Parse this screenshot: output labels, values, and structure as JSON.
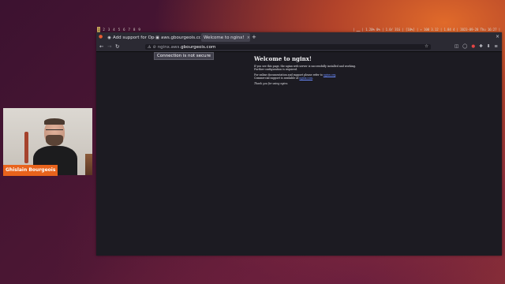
{
  "system_bar": {
    "workspaces": [
      "1",
      "2",
      "3",
      "4",
      "5",
      "6",
      "7",
      "8",
      "9"
    ],
    "active_workspace_index": 0,
    "status_text": "| ▁▁ | 1.20% 0% | 1.0/ 31G | [10%] | ↑ 100 3.12 | 1.84 4 | 2023-09-28 Thu 16:27 |"
  },
  "browser": {
    "menu_icon": "firefox-menu-icon",
    "tabs": [
      {
        "label": "Add support for OpenTelemetr",
        "icon": "github-icon",
        "active": false
      },
      {
        "label": "aws.gbourgeois.com",
        "icon": "generic-page-icon",
        "active": false
      },
      {
        "label": "Welcome to nginx!",
        "icon": "",
        "active": true
      }
    ],
    "new_tab_label": "+",
    "window_close_label": "×",
    "url": {
      "prefix": "nginx.aws.",
      "host": "gbourgeois.com"
    },
    "tooltip": "Connection is not secure"
  },
  "page": {
    "heading": "Welcome to nginx!",
    "paragraph1": "If you see this page, the nginx web server is successfully installed and working. Further configuration is required.",
    "paragraph2_pre": "For online documentation and support please refer to ",
    "paragraph2_link1": "nginx.org",
    "paragraph2_mid": ".\nCommercial support is available at ",
    "paragraph2_link2": "nginx.com",
    "paragraph2_post": ".",
    "paragraph3": "Thank you for using nginx."
  },
  "webcam": {
    "name_tag": "Ghislain Bourgeois",
    "accent_color": "#e8631c"
  }
}
